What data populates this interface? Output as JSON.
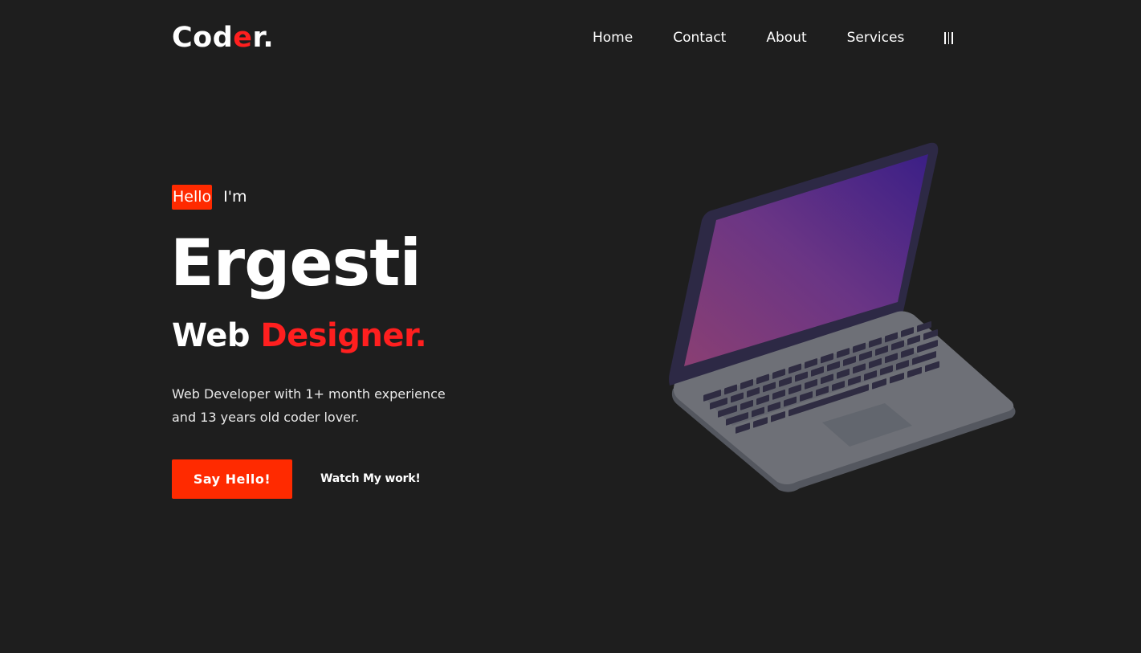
{
  "logo": {
    "part1": "Cod",
    "accent": "e",
    "part2": "r."
  },
  "nav": {
    "items": [
      {
        "label": "Home"
      },
      {
        "label": "Contact"
      },
      {
        "label": "About"
      },
      {
        "label": "Services"
      }
    ],
    "menu_icon": "hamburger-vertical-icon"
  },
  "hero": {
    "badge": "Hello",
    "intro": "I'm",
    "name": "Ergesti",
    "role_prefix": "Web",
    "role_highlight": "Designer.",
    "description_line1": "Web Developer with 1+ month experience",
    "description_line2": "and 13 years old coder lover.",
    "primary_button": "Say Hello!",
    "secondary_link": "Watch My work!"
  },
  "colors": {
    "background": "#1e1e1e",
    "accent": "#ff2a00",
    "accent_text": "#ff1f1f",
    "text": "#ffffff"
  },
  "illustration": {
    "icon": "laptop-illustration"
  }
}
